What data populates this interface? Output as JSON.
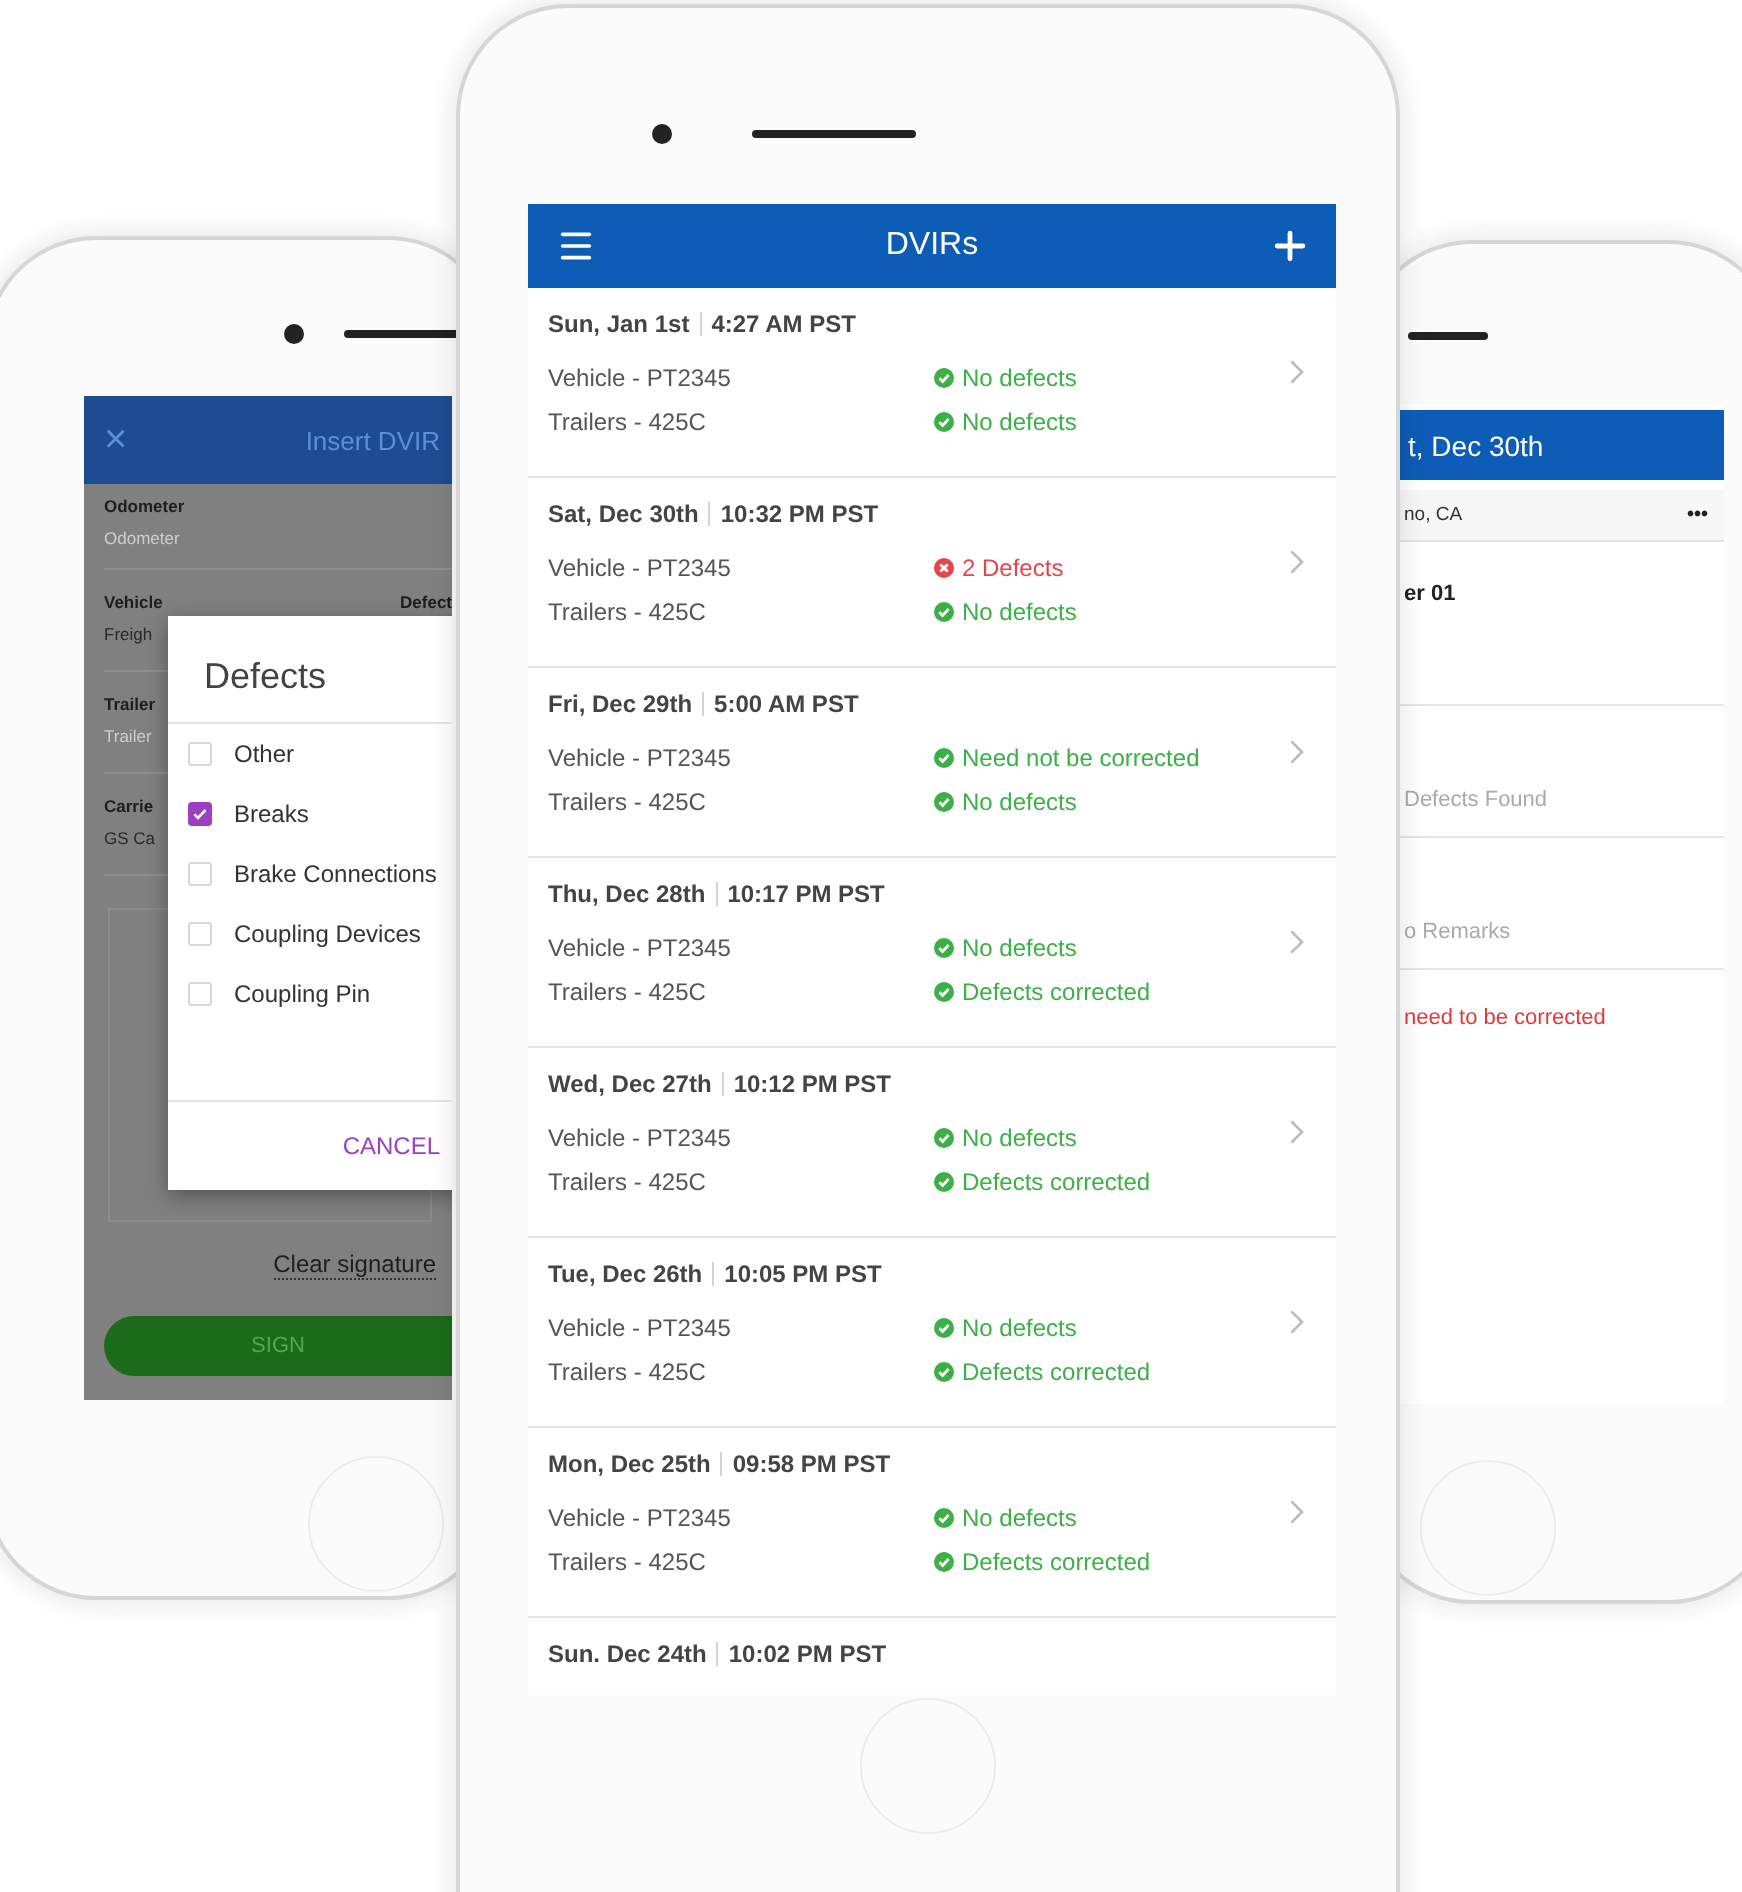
{
  "left_phone": {
    "header": {
      "close": "×",
      "title": "Insert DVIR"
    },
    "fields": [
      {
        "label": "Odometer",
        "placeholder": "Odometer"
      },
      {
        "label": "Vehicle",
        "value": "Freigh",
        "right_label": "Defect"
      },
      {
        "label": "Trailer",
        "placeholder": "Trailer"
      },
      {
        "label": "Carrie",
        "value": "GS Ca"
      }
    ],
    "clear_signature": "Clear signature",
    "sign_button": "SIGN",
    "dialog": {
      "title": "Defects",
      "options": [
        {
          "label": "Other",
          "checked": false
        },
        {
          "label": "Breaks",
          "checked": true
        },
        {
          "label": "Brake Connections",
          "checked": false
        },
        {
          "label": "Coupling Devices",
          "checked": false
        },
        {
          "label": "Coupling Pin",
          "checked": false
        }
      ],
      "cancel": "CANCEL"
    }
  },
  "center_phone": {
    "header": {
      "title": "DVIRs"
    },
    "entries": [
      {
        "date": "Sun, Jan 1st",
        "time": "4:27 AM PST",
        "vehicle": "Vehicle - PT2345",
        "vehicle_status": {
          "text": "No defects",
          "kind": "ok"
        },
        "trailer": "Trailers - 425C",
        "trailer_status": {
          "text": "No defects",
          "kind": "ok"
        }
      },
      {
        "date": "Sat, Dec 30th",
        "time": "10:32 PM PST",
        "vehicle": "Vehicle - PT2345",
        "vehicle_status": {
          "text": "2 Defects",
          "kind": "defect"
        },
        "trailer": "Trailers - 425C",
        "trailer_status": {
          "text": "No defects",
          "kind": "ok"
        }
      },
      {
        "date": "Fri, Dec 29th",
        "time": "5:00 AM PST",
        "vehicle": "Vehicle - PT2345",
        "vehicle_status": {
          "text": "Need not be corrected",
          "kind": "ok"
        },
        "trailer": "Trailers - 425C",
        "trailer_status": {
          "text": "No defects",
          "kind": "ok"
        }
      },
      {
        "date": "Thu, Dec 28th",
        "time": "10:17 PM PST",
        "vehicle": "Vehicle - PT2345",
        "vehicle_status": {
          "text": "No defects",
          "kind": "ok"
        },
        "trailer": "Trailers - 425C",
        "trailer_status": {
          "text": "Defects corrected",
          "kind": "ok"
        }
      },
      {
        "date": "Wed, Dec 27th",
        "time": "10:12 PM PST",
        "vehicle": "Vehicle - PT2345",
        "vehicle_status": {
          "text": "No defects",
          "kind": "ok"
        },
        "trailer": "Trailers - 425C",
        "trailer_status": {
          "text": "Defects corrected",
          "kind": "ok"
        }
      },
      {
        "date": "Tue, Dec 26th",
        "time": "10:05 PM PST",
        "vehicle": "Vehicle - PT2345",
        "vehicle_status": {
          "text": "No defects",
          "kind": "ok"
        },
        "trailer": "Trailers - 425C",
        "trailer_status": {
          "text": "Defects corrected",
          "kind": "ok"
        }
      },
      {
        "date": "Mon, Dec 25th",
        "time": "09:58 PM PST",
        "vehicle": "Vehicle - PT2345",
        "vehicle_status": {
          "text": "No defects",
          "kind": "ok"
        },
        "trailer": "Trailers - 425C",
        "trailer_status": {
          "text": "Defects corrected",
          "kind": "ok"
        }
      },
      {
        "date": "Sun. Dec 24th",
        "time": "10:02 PM PST"
      }
    ]
  },
  "right_phone": {
    "header": {
      "title": "t, Dec 30th"
    },
    "location": "no, CA",
    "more": "•••",
    "driver": "er 01",
    "sections": [
      {
        "text": "Defects Found",
        "kind": "muted"
      },
      {
        "text": "o Remarks",
        "kind": "muted"
      },
      {
        "text": "need to be corrected",
        "kind": "alert"
      }
    ]
  }
}
